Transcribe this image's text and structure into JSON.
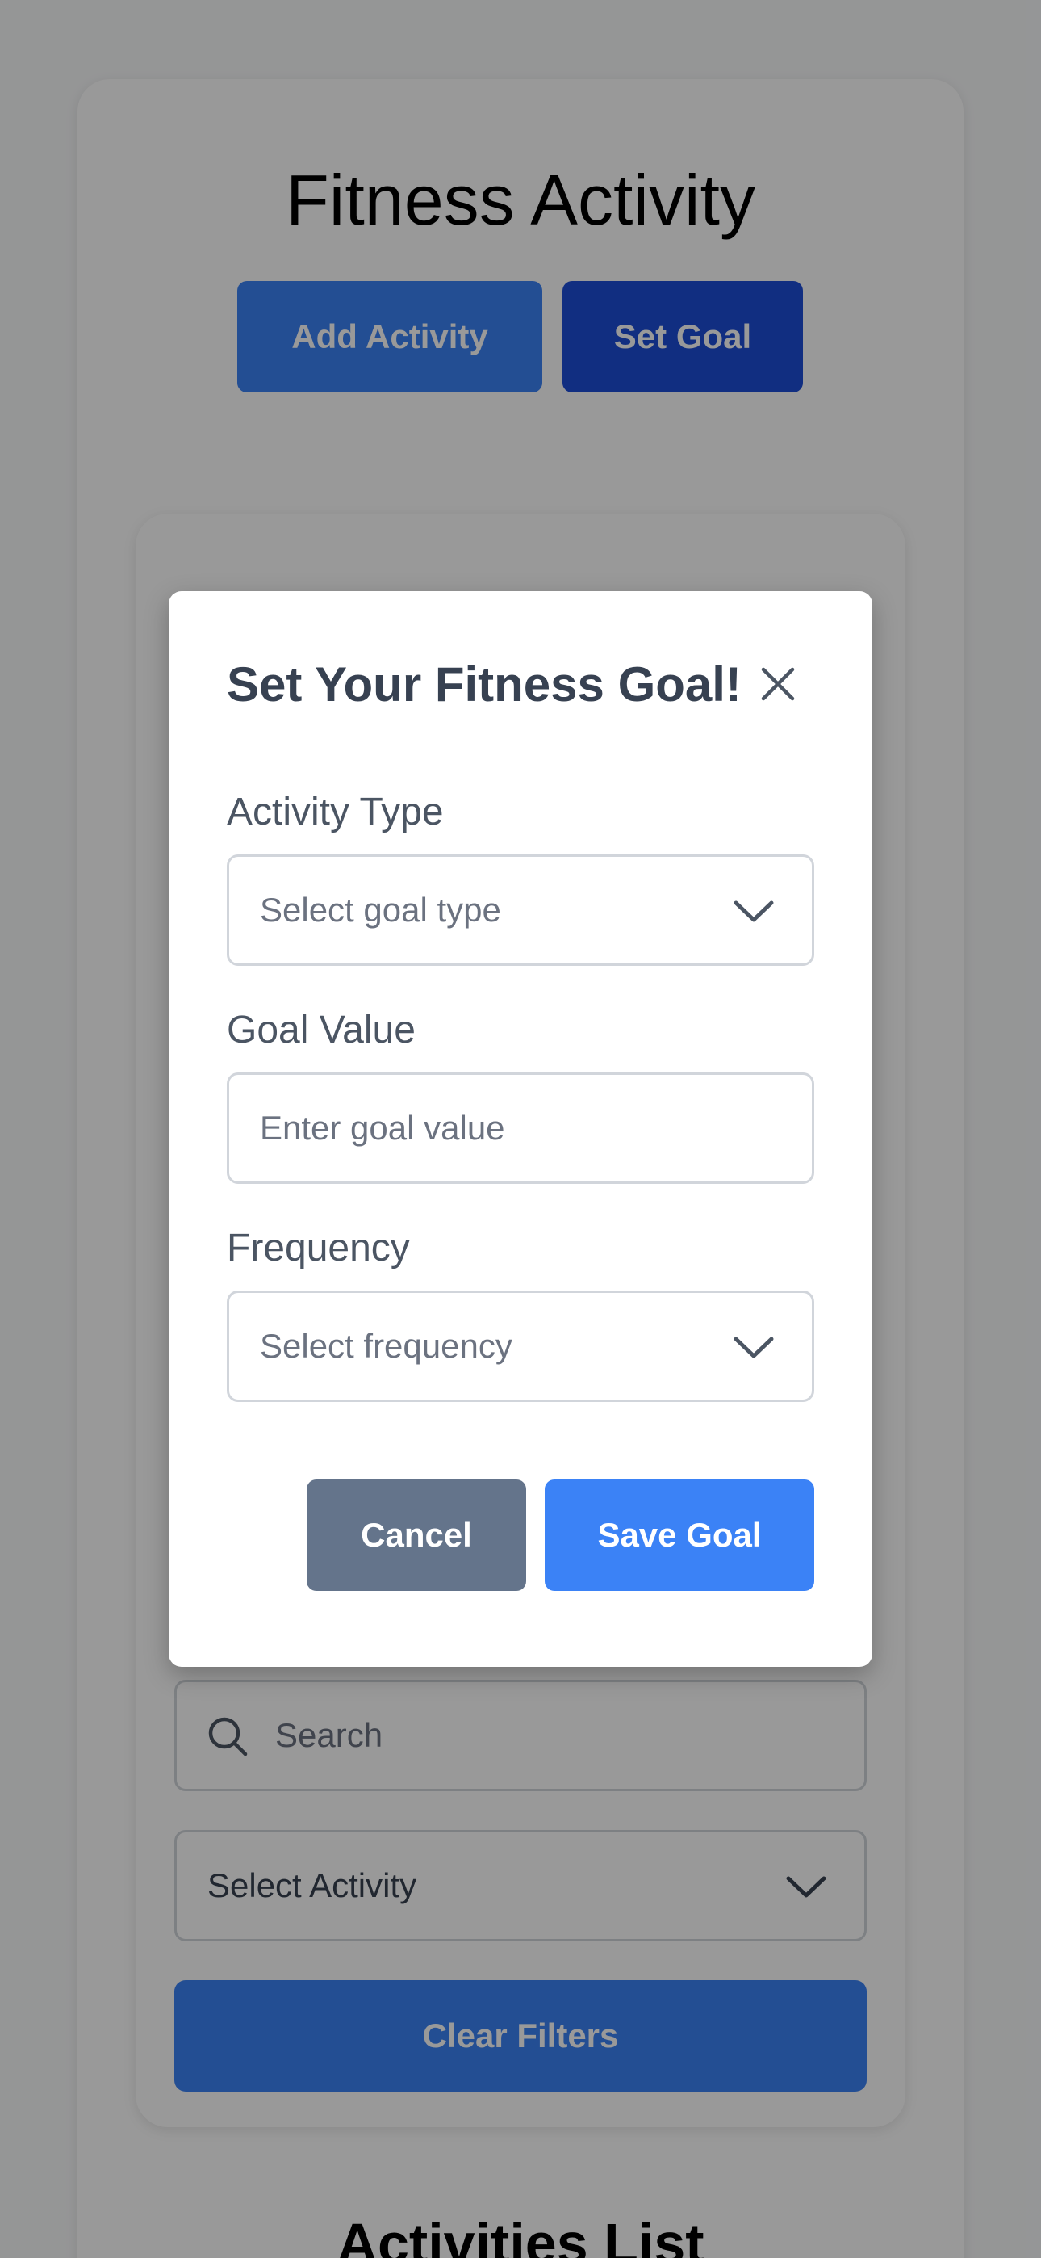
{
  "page": {
    "title": "Fitness Activity",
    "buttons": {
      "add_activity": "Add Activity",
      "set_goal": "Set Goal"
    }
  },
  "filters": {
    "search_placeholder": "Search",
    "activity_select": "Select Activity",
    "clear_filters": "Clear Filters"
  },
  "list": {
    "title": "Activities List"
  },
  "modal": {
    "title": "Set Your Fitness Goal!",
    "fields": {
      "activity_type": {
        "label": "Activity Type",
        "placeholder": "Select goal type"
      },
      "goal_value": {
        "label": "Goal Value",
        "placeholder": "Enter goal value"
      },
      "frequency": {
        "label": "Frequency",
        "placeholder": "Select frequency"
      }
    },
    "buttons": {
      "cancel": "Cancel",
      "save": "Save Goal"
    }
  },
  "colors": {
    "primary": "#3b82f6",
    "primary_dark": "#1d4ed8",
    "secondary": "#64748b",
    "overlay": "rgba(0,0,0,0.40)"
  },
  "icons": {
    "close": "close-icon",
    "search": "search-icon",
    "chevron": "chevron-down-icon"
  }
}
